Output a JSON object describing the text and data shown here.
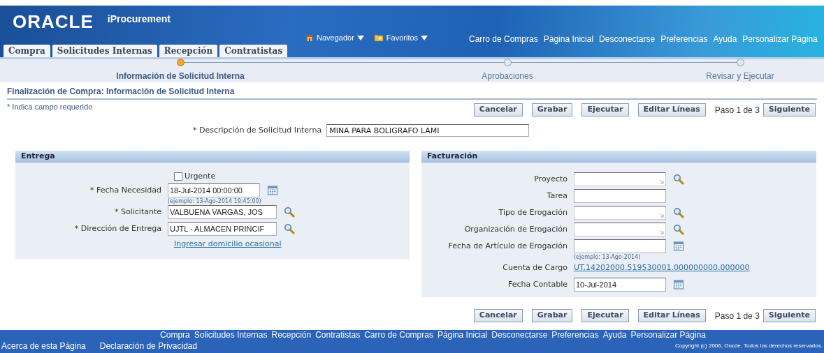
{
  "header": {
    "logo": "ORACLE",
    "product": "iProcurement",
    "menus": [
      {
        "label": "Navegador",
        "kind": "home"
      },
      {
        "label": "Favoritos",
        "kind": "favorites"
      }
    ],
    "links": [
      "Carro de Compras",
      "Página Inicial",
      "Desconectarse",
      "Preferencias",
      "Ayuda",
      "Personalizar Página"
    ]
  },
  "tabs": [
    "Compra",
    "Solicitudes Internas",
    "Recepción",
    "Contratistas"
  ],
  "train": [
    {
      "label": "Información de Solicitud Interna",
      "selected": true
    },
    {
      "label": "Aprobaciones",
      "selected": false
    },
    {
      "label": "Revisar y Ejecutar",
      "selected": false
    }
  ],
  "page_title": "Finalización de Compra: Información de Solicitud Interna",
  "required_note": "* Indica campo requerido",
  "top_actions": {
    "buttons": [
      "Cancelar",
      "Grabar",
      "Ejecutar",
      "Editar Líneas"
    ],
    "step": "Paso 1 de 3",
    "next": "Siguiente"
  },
  "description": {
    "label": "* Descripción de Solicitud Interna",
    "value": "MINA PARA BOLIGRAFO LAMI"
  },
  "entrega": {
    "title": "Entrega",
    "urgent": {
      "label": "Urgente",
      "checked": false
    },
    "fields": [
      {
        "label": "* Fecha Necesidad",
        "value": "18-Jul-2014 00:00:00",
        "kind": "date",
        "hint": "(ejemplo: 13-Ago-2014 19:45:00)"
      },
      {
        "label": "* Solicitante",
        "value": "VALBUENA VARGAS, JOS",
        "kind": "lov"
      },
      {
        "label": "* Dirección de Entrega",
        "value": "UJTL - ALMACEN PRINCIF",
        "kind": "lov"
      }
    ],
    "link": "Ingresar domicilio ocasional"
  },
  "facturacion": {
    "title": "Facturación",
    "fields": [
      {
        "label": "Proyecto",
        "kind": "combo"
      },
      {
        "label": "Tarea",
        "kind": "text"
      },
      {
        "label": "Tipo de Erogación",
        "kind": "combo"
      },
      {
        "label": "Organización de Erogación",
        "kind": "combo"
      },
      {
        "label": "Fecha de Artículo de Erogación",
        "kind": "date",
        "hint": "(ejemplo: 13-Ago-2014)"
      },
      {
        "label": "Cuenta de Cargo",
        "kind": "link",
        "value": "UT.14202000.519530001.000000000.000000"
      },
      {
        "label": "Fecha Contable",
        "kind": "date",
        "value": "10-Jul-2014"
      }
    ]
  },
  "bottom_actions": {
    "buttons": [
      "Cancelar",
      "Grabar",
      "Ejecutar",
      "Editar Líneas"
    ],
    "step": "Paso 1 de 3",
    "next": "Siguiente"
  },
  "footer": {
    "links": [
      "Compra",
      "Solicitudes Internas",
      "Recepción",
      "Contratistas",
      "Carro de Compras",
      "Página Inicial",
      "Desconectarse",
      "Preferencias",
      "Ayuda",
      "Personalizar Página"
    ],
    "bottom_links": [
      "Acerca de esta Página",
      "Declaración de Privacidad"
    ],
    "copyright": "Copyright (c) 2006, Oracle. Todos los derechos reservados."
  }
}
